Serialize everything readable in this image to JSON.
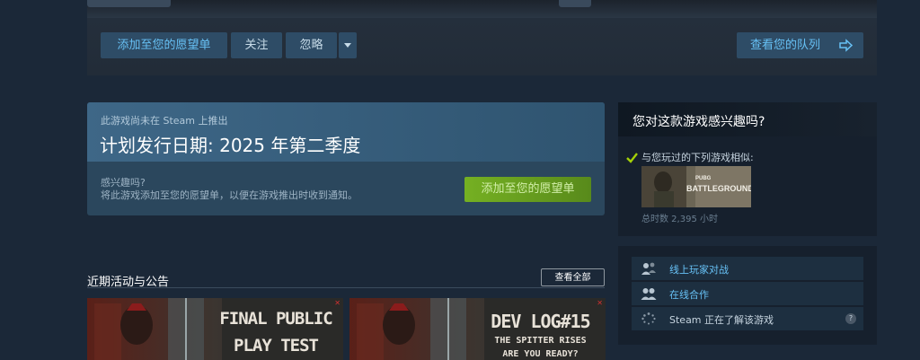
{
  "toolbar": {
    "add_wishlist": "添加至您的愿望单",
    "follow": "关注",
    "ignore": "忽略",
    "view_queue": "查看您的队列"
  },
  "release": {
    "subtitle": "此游戏尚未在 Steam 上推出",
    "title": "计划发行日期: 2025 年第二季度",
    "interest_question": "感兴趣吗?",
    "interest_desc": "将此游戏添加至您的愿望单，以便在游戏推出时收到通知。",
    "wishlist_button": "添加至您的愿望单"
  },
  "news": {
    "heading": "近期活动与公告",
    "view_all": "查看全部",
    "cards": [
      {
        "line1": "FINAL PUBLIC",
        "line2": "PLAY TEST"
      },
      {
        "line1": "DEV LOG#15",
        "line2": "THE SPITTER RISES",
        "line3": "ARE YOU READY?"
      }
    ]
  },
  "interest_panel": {
    "title": "您对这款游戏感兴趣吗?",
    "similar_label": "与您玩过的下列游戏相似:",
    "game_thumb_top": "PUBG",
    "game_thumb_main": "BATTLEGROUNDS",
    "hours_text": "总时数 2,395 小时"
  },
  "features": [
    {
      "label": "线上玩家对战",
      "icon": "multiplayer-icon",
      "link": true
    },
    {
      "label": "在线合作",
      "icon": "coop-icon",
      "link": true
    },
    {
      "label": "Steam 正在了解该游戏",
      "icon": "loading-icon",
      "link": false,
      "help": "?"
    }
  ],
  "colors": {
    "background": "#1b2838",
    "accent_blue": "#67c1f5",
    "green_button": "#75b022",
    "panel_blue": "#3e6787"
  }
}
